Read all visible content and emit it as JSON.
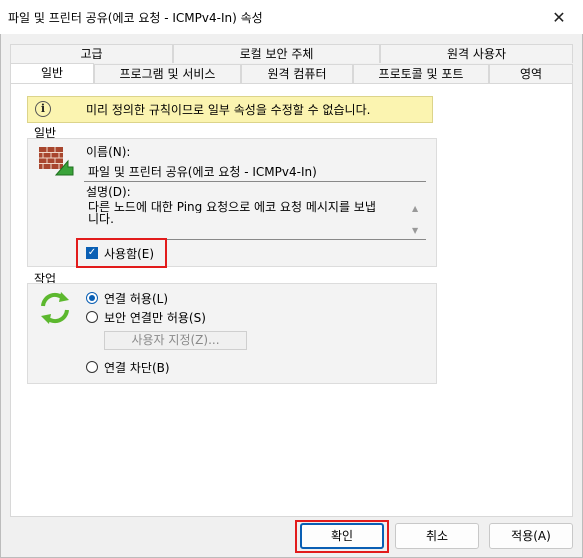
{
  "window": {
    "title": "파일 및 프린터 공유(에코 요청 - ICMPv4-In) 속성",
    "close_glyph": "✕"
  },
  "tabs_row1": [
    {
      "label": "고급"
    },
    {
      "label": "로컬 보안 주체"
    },
    {
      "label": "원격 사용자"
    }
  ],
  "tabs_row2": [
    {
      "label": "일반",
      "active": true
    },
    {
      "label": "프로그램 및 서비스"
    },
    {
      "label": "원격 컴퓨터"
    },
    {
      "label": "프로토콜 및 포트"
    },
    {
      "label": "영역"
    }
  ],
  "info": {
    "icon": "info-icon",
    "message": "미리 정의한 규칙이므로 일부 속성을 수정할 수 없습니다."
  },
  "general": {
    "group_label": "일반",
    "icon": "firewall-rule-icon",
    "name_label": "이름(N):",
    "name_value": "파일 및 프린터 공유(에코 요청 - ICMPv4-In)",
    "desc_label": "설명(D):",
    "desc_line1": "다른 노드에 대한 Ping 요청으로 에코 요청 메시지를 보냅",
    "desc_line2": "니다.",
    "enabled_label": "사용함(E)",
    "enabled": true
  },
  "action": {
    "group_label": "작업",
    "icon": "refresh-arrows-icon",
    "options": [
      {
        "label": "연결 허용(L)",
        "selected": true
      },
      {
        "label": "보안 연결만 허용(S)",
        "selected": false
      },
      {
        "label": "연결 차단(B)",
        "selected": false
      }
    ],
    "customize_label": "사용자 지정(Z)..."
  },
  "buttons": {
    "ok": "확인",
    "cancel": "취소",
    "apply": "적용(A)"
  },
  "colors": {
    "accent": "#0a5fb4",
    "highlight_red": "#e21b1b",
    "info_bg": "#fbf4b0"
  }
}
